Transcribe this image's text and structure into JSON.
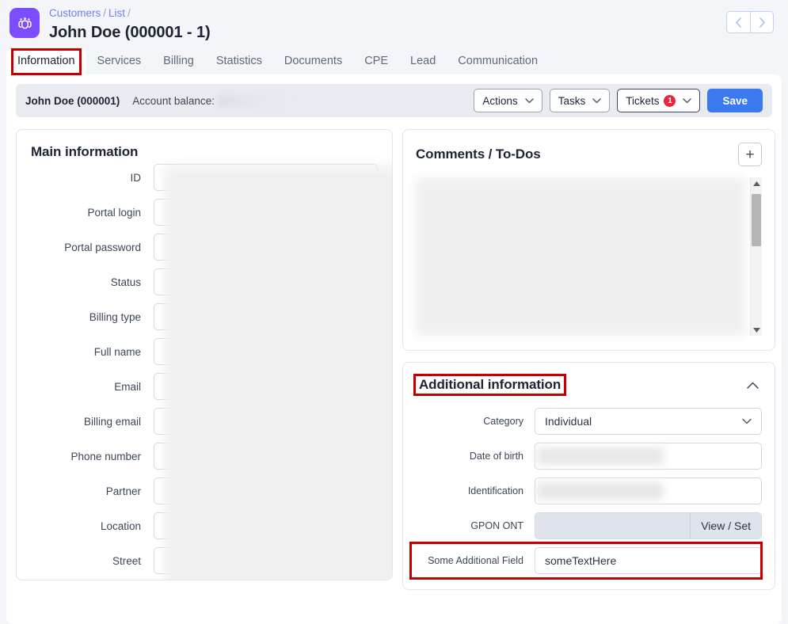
{
  "header": {
    "app_icon": "customers-group-icon",
    "breadcrumb": [
      "Customers",
      "List"
    ],
    "breadcrumb_separator": "/",
    "title": "John Doe (000001 - 1)",
    "prev_label": "‹",
    "next_label": "›"
  },
  "tabs": [
    {
      "label": "Information",
      "active": true,
      "highlighted": true
    },
    {
      "label": "Services",
      "active": false
    },
    {
      "label": "Billing",
      "active": false
    },
    {
      "label": "Statistics",
      "active": false
    },
    {
      "label": "Documents",
      "active": false
    },
    {
      "label": "CPE",
      "active": false
    },
    {
      "label": "Lead",
      "active": false
    },
    {
      "label": "Communication",
      "active": false
    }
  ],
  "toolbar": {
    "customer_name": "John Doe (000001)",
    "balance_label": "Account balance:",
    "balance_value": "",
    "actions_label": "Actions",
    "tasks_label": "Tasks",
    "tickets_label": "Tickets",
    "tickets_badge": "1",
    "save_label": "Save"
  },
  "main_information": {
    "title": "Main information",
    "fields": [
      {
        "label": "ID",
        "value": ""
      },
      {
        "label": "Portal login",
        "value": ""
      },
      {
        "label": "Portal password",
        "value": ""
      },
      {
        "label": "Status",
        "value": ""
      },
      {
        "label": "Billing type",
        "value": ""
      },
      {
        "label": "Full name",
        "value": ""
      },
      {
        "label": "Email",
        "value": ""
      },
      {
        "label": "Billing email",
        "value": ""
      },
      {
        "label": "Phone number",
        "value": ""
      },
      {
        "label": "Partner",
        "value": ""
      },
      {
        "label": "Location",
        "value": ""
      },
      {
        "label": "Street",
        "value": ""
      },
      {
        "label": "",
        "value": ""
      }
    ]
  },
  "comments": {
    "title": "Comments / To-Dos",
    "add_label": "+",
    "scroll_up": "▲",
    "scroll_down": "▼"
  },
  "additional_information": {
    "title": "Additional information",
    "collapse_icon": "chevron-up-icon",
    "highlighted": true,
    "fields": [
      {
        "label": "Category",
        "value": "Individual",
        "type": "select"
      },
      {
        "label": "Date of birth",
        "value": "",
        "type": "text-redacted"
      },
      {
        "label": "Identification",
        "value": "",
        "type": "text-redacted"
      },
      {
        "label": "GPON ONT",
        "value": "",
        "type": "input-group",
        "button_label": "View / Set"
      },
      {
        "label": "Some Additional Field",
        "value": "someTextHere",
        "type": "text",
        "highlighted": true
      }
    ]
  },
  "colors": {
    "page_background": "#f4f5f9",
    "accent_primary": "#3b79f0",
    "brand_purple": "#7c4dff",
    "badge_red": "#e8253c",
    "highlight_red": "#c20000",
    "link_blue": "#6d7ff5"
  }
}
